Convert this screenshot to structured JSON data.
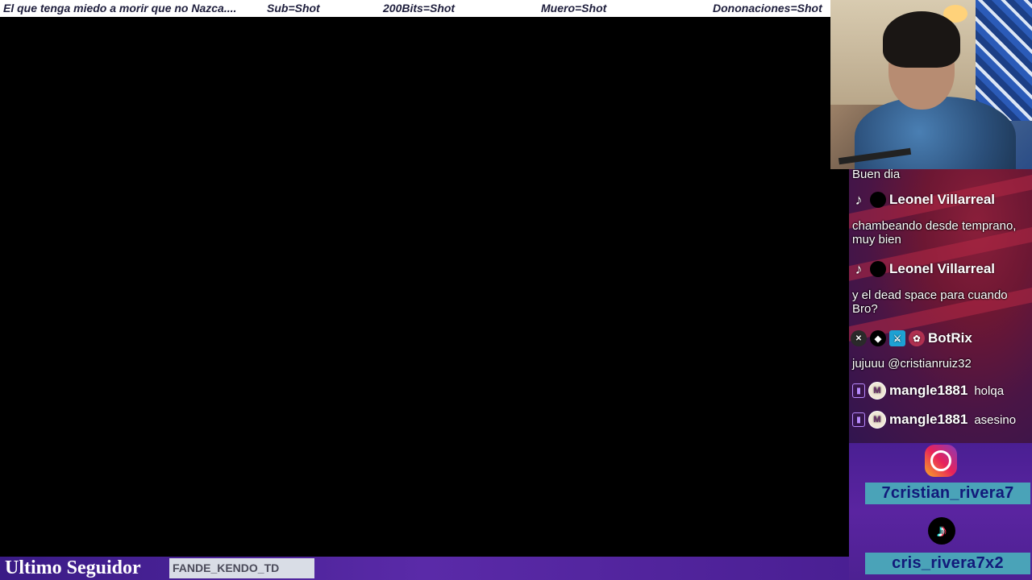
{
  "ticker": {
    "items": [
      "El que tenga miedo a morir que no Nazca....",
      "Sub=Shot",
      "200Bits=Shot",
      "Muero=Shot",
      "Dononaciones=Shot"
    ]
  },
  "chat": {
    "messages": [
      {
        "text": "Buen dia"
      },
      {
        "platform": "tiktok-icon",
        "user": "Leonel Villarreal",
        "text": "chambeando desde temprano, muy bien"
      },
      {
        "platform": "tiktok-icon",
        "user": "Leonel Villarreal",
        "text": "y el dead space para cuando Bro?"
      },
      {
        "platform": "bot-badges",
        "user": "BotRix",
        "text": "jujuuu @cristianruiz32"
      },
      {
        "platform": "twitch-icon",
        "user": "mangle1881",
        "text": "holqa"
      },
      {
        "platform": "twitch-icon",
        "user": "mangle1881",
        "text": "asesino"
      }
    ]
  },
  "socials": {
    "instagram_icon": "instagram-icon",
    "instagram_handle": "7cristian_rivera7",
    "tiktok_icon": "tiktok-icon",
    "tiktok_handle": "cris_rivera7x2"
  },
  "follower": {
    "label": "Ultimo Seguidor",
    "name": "FANDE_KENDO_TD"
  },
  "colors": {
    "ticker_bg": "#ffffff",
    "ticker_text": "#1e1e3c",
    "handle_bg": "#4aa3b8",
    "handle_text": "#121a7a",
    "bottom_bar": "#4a1f93"
  }
}
